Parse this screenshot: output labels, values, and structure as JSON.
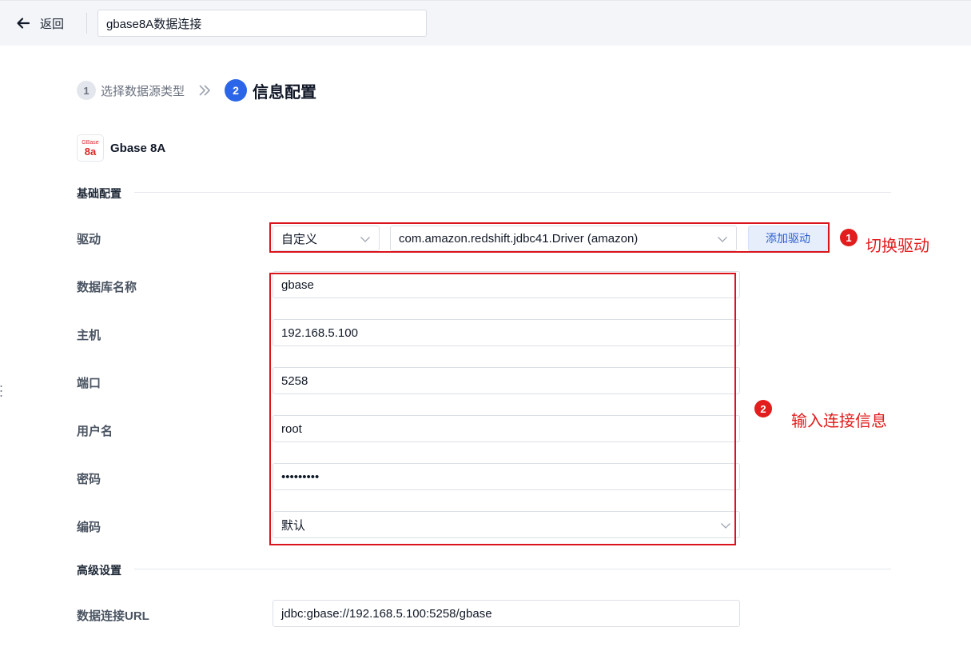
{
  "header": {
    "back_label": "返回",
    "title_value": "gbase8A数据连接"
  },
  "steps": [
    {
      "num": "1",
      "label": "选择数据源类型"
    },
    {
      "num": "2",
      "label": "信息配置"
    }
  ],
  "datasource": {
    "logo_top": "GBase",
    "logo_bottom": "8a",
    "name": "Gbase 8A"
  },
  "basic": {
    "title": "基础配置",
    "driver_label": "驱动",
    "driver_mode": "自定义",
    "driver_class": "com.amazon.redshift.jdbc41.Driver (amazon)",
    "add_driver_label": "添加驱动",
    "db_name_label": "数据库名称",
    "db_name_value": "gbase",
    "host_label": "主机",
    "host_value": "192.168.5.100",
    "port_label": "端口",
    "port_value": "5258",
    "user_label": "用户名",
    "user_value": "root",
    "password_label": "密码",
    "password_value": "•••••••••",
    "encoding_label": "编码",
    "encoding_value": "默认"
  },
  "advanced": {
    "title": "高级设置",
    "url_label": "数据连接URL",
    "url_value": "jdbc:gbase://192.168.5.100:5258/gbase"
  },
  "annotations": [
    {
      "num": "1",
      "text": "切换驱动"
    },
    {
      "num": "2",
      "text": "输入连接信息"
    }
  ],
  "colors": {
    "accent": "#2c66e8",
    "annotation": "#e11d1d",
    "add_driver_bg": "#e6edfb"
  }
}
